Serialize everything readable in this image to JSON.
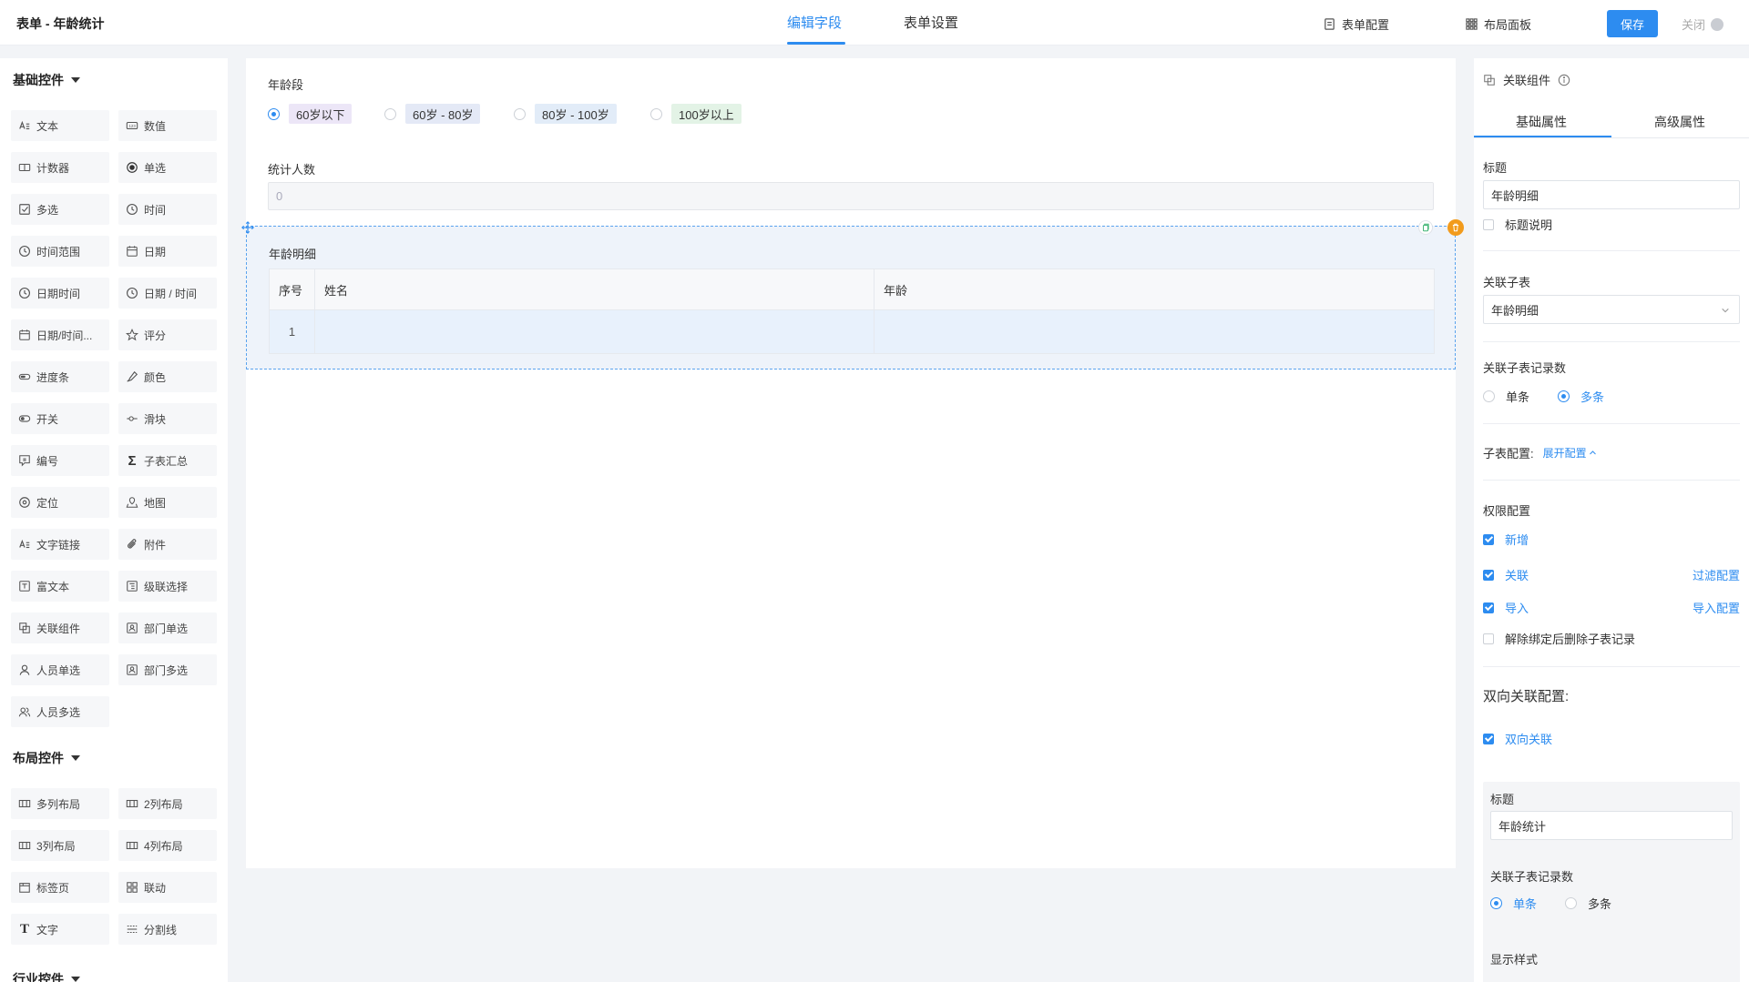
{
  "header": {
    "title": "表单 - 年龄统计",
    "tabs": [
      {
        "label": "编辑字段"
      },
      {
        "label": "表单设置"
      }
    ],
    "actions": {
      "form_config": "表单配置",
      "layout_panel": "布局面板",
      "save": "保存",
      "close": "关闭"
    }
  },
  "palette": {
    "basic_title": "基础控件",
    "basic_items": [
      {
        "label": "文本",
        "icon": "text-icon"
      },
      {
        "label": "数值",
        "icon": "number-icon"
      },
      {
        "label": "计数器",
        "icon": "counter-icon"
      },
      {
        "label": "单选",
        "icon": "radio-icon"
      },
      {
        "label": "多选",
        "icon": "checkbox-icon"
      },
      {
        "label": "时间",
        "icon": "clock-icon"
      },
      {
        "label": "时间范围",
        "icon": "clock-icon"
      },
      {
        "label": "日期",
        "icon": "calendar-icon"
      },
      {
        "label": "日期时间",
        "icon": "clock-icon"
      },
      {
        "label": "日期 / 时间",
        "icon": "clock-icon"
      },
      {
        "label": "日期/时间...",
        "icon": "calendar-icon"
      },
      {
        "label": "评分",
        "icon": "star-icon"
      },
      {
        "label": "进度条",
        "icon": "progress-icon"
      },
      {
        "label": "颜色",
        "icon": "dropper-icon"
      },
      {
        "label": "开关",
        "icon": "toggle-icon"
      },
      {
        "label": "滑块",
        "icon": "slider-icon"
      },
      {
        "label": "编号",
        "icon": "numbering-icon"
      },
      {
        "label": "子表汇总",
        "icon": "sigma-icon"
      },
      {
        "label": "定位",
        "icon": "location-icon"
      },
      {
        "label": "地图",
        "icon": "map-icon"
      },
      {
        "label": "文字链接",
        "icon": "text-link-icon"
      },
      {
        "label": "附件",
        "icon": "paperclip-icon"
      },
      {
        "label": "富文本",
        "icon": "richtext-icon"
      },
      {
        "label": "级联选择",
        "icon": "cascade-icon"
      },
      {
        "label": "关联组件",
        "icon": "link-component-icon"
      },
      {
        "label": "部门单选",
        "icon": "department-icon"
      },
      {
        "label": "人员单选",
        "icon": "user-icon"
      },
      {
        "label": "部门多选",
        "icon": "department-icon"
      },
      {
        "label": "人员多选",
        "icon": "users-icon"
      }
    ],
    "layout_title": "布局控件",
    "layout_items": [
      {
        "label": "多列布局",
        "icon": "columns-icon"
      },
      {
        "label": "2列布局",
        "icon": "columns-icon"
      },
      {
        "label": "3列布局",
        "icon": "columns-icon"
      },
      {
        "label": "4列布局",
        "icon": "columns-icon"
      },
      {
        "label": "标签页",
        "icon": "tabs-icon"
      },
      {
        "label": "联动",
        "icon": "linkage-icon"
      },
      {
        "label": "文字",
        "icon": "type-icon"
      },
      {
        "label": "分割线",
        "icon": "divider-icon"
      }
    ],
    "industry_title": "行业控件"
  },
  "canvas": {
    "age_group": {
      "label": "年龄段",
      "options": [
        {
          "label": "60岁以下",
          "color": "#ece6f7",
          "checked": true
        },
        {
          "label": "60岁 - 80岁",
          "color": "#e4e9f6",
          "checked": false
        },
        {
          "label": "80岁 - 100岁",
          "color": "#e2ecf8",
          "checked": false
        },
        {
          "label": "100岁以上",
          "color": "#e3f3e6",
          "checked": false
        }
      ]
    },
    "count": {
      "label": "统计人数",
      "placeholder": "0"
    },
    "subform": {
      "title": "年龄明细",
      "columns": [
        "序号",
        "姓名",
        "年龄"
      ],
      "rows": [
        [
          "1",
          "",
          ""
        ]
      ]
    }
  },
  "props": {
    "component": "关联组件",
    "tabs": [
      "基础属性",
      "高级属性"
    ],
    "title_label": "标题",
    "title_value": "年龄明细",
    "title_desc": "标题说明",
    "linked_table_label": "关联子表",
    "linked_table_value": "年龄明细",
    "record_count_label": "关联子表记录数",
    "record_single": "单条",
    "record_multi": "多条",
    "subtable_config_label": "子表配置:",
    "subtable_config_link": "展开配置",
    "permission_label": "权限配置",
    "perm_add": "新增",
    "perm_link": "关联",
    "perm_link_action": "过滤配置",
    "perm_import": "导入",
    "perm_import_action": "导入配置",
    "perm_unbind": "解除绑定后删除子表记录",
    "bidirectional_label": "双向关联配置:",
    "bidirectional_check": "双向关联",
    "inner": {
      "title_label": "标题",
      "title_value": "年龄统计",
      "record_count_label": "关联子表记录数",
      "record_single": "单条",
      "record_multi": "多条",
      "display_style_label": "显示样式"
    }
  },
  "colors": {
    "accent": "#2d8cf0",
    "delete": "#f29b1c"
  }
}
